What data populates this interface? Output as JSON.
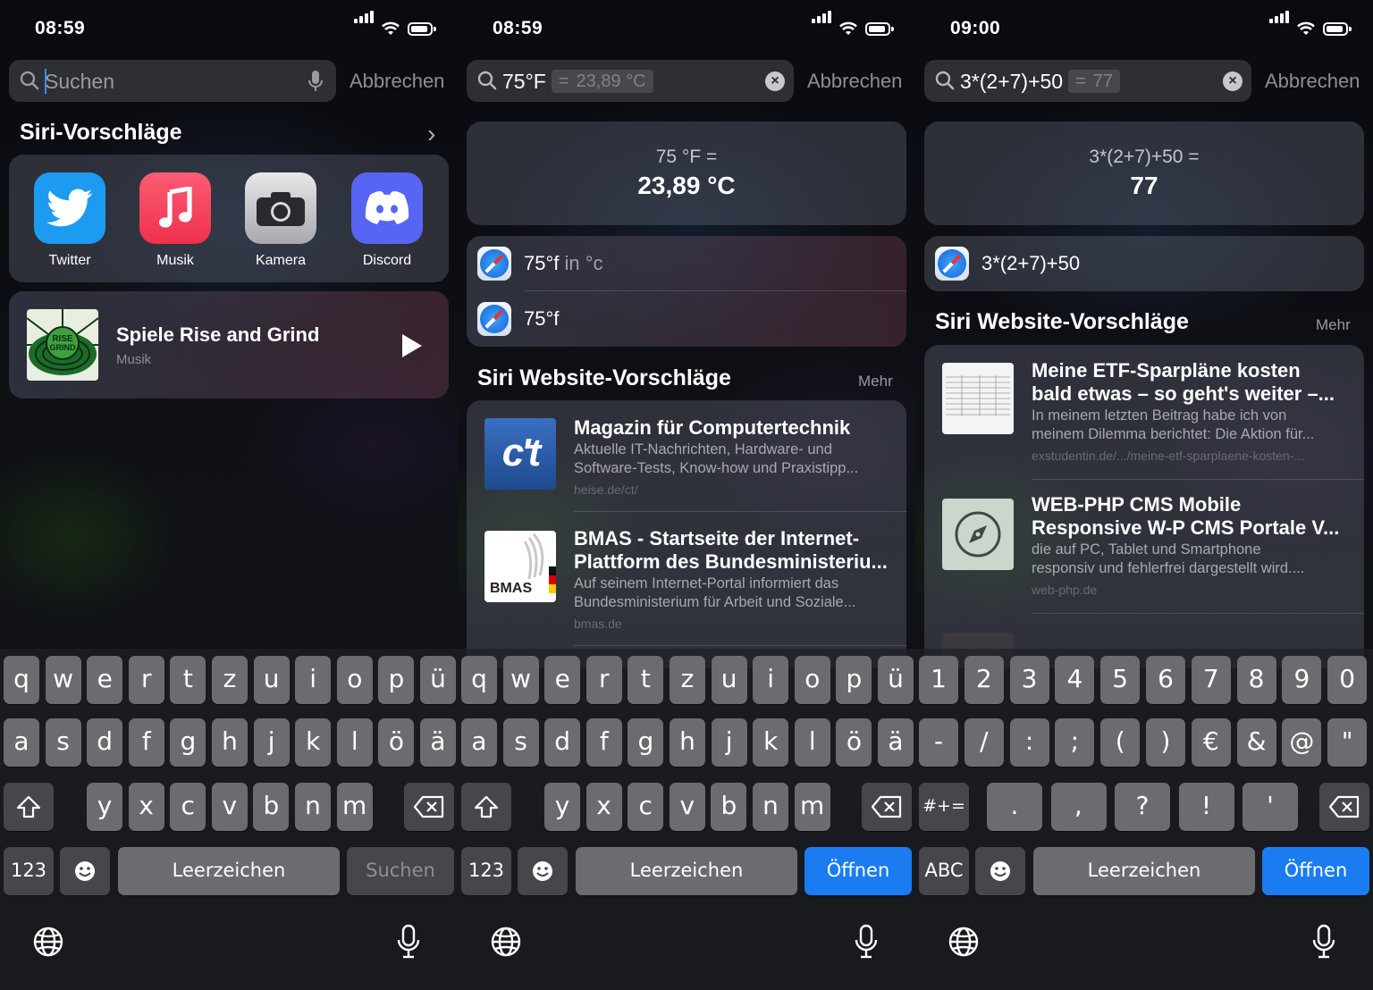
{
  "screens": [
    {
      "status": {
        "time": "08:59"
      },
      "search": {
        "query": "",
        "placeholder": "Suchen",
        "cancel": "Abbrechen"
      },
      "siri_suggestions": {
        "title": "Siri-Vorschläge",
        "apps": [
          {
            "label": "Twitter",
            "icon": "twitter-bird-icon",
            "color": "#1d9bf0"
          },
          {
            "label": "Musik",
            "icon": "music-note-icon",
            "color": "#f0405a"
          },
          {
            "label": "Kamera",
            "icon": "camera-icon",
            "color": "#c8c8cc"
          },
          {
            "label": "Discord",
            "icon": "discord-icon",
            "color": "#5865f2"
          }
        ]
      },
      "now_playing": {
        "art_text": "RISE AND GRIND",
        "title": "Spiele Rise and Grind",
        "subtitle": "Musik"
      },
      "keyboard": {
        "row1": [
          "q",
          "w",
          "e",
          "r",
          "t",
          "z",
          "u",
          "i",
          "o",
          "p",
          "ü"
        ],
        "row2": [
          "a",
          "s",
          "d",
          "f",
          "g",
          "h",
          "j",
          "k",
          "l",
          "ö",
          "ä"
        ],
        "row3": [
          "y",
          "x",
          "c",
          "v",
          "b",
          "n",
          "m"
        ],
        "mode_key": "123",
        "space": "Leerzeichen",
        "action": "Suchen"
      }
    },
    {
      "status": {
        "time": "08:59"
      },
      "search": {
        "query": "75°F",
        "result_eq": "=",
        "result": "23,89 °C",
        "cancel": "Abbrechen"
      },
      "conversion": {
        "expression": "75 °F =",
        "result": "23,89 °C"
      },
      "suggestions": [
        {
          "bold": "75°f",
          "rest": " in °c"
        },
        {
          "bold": "75°f",
          "rest": ""
        }
      ],
      "web": {
        "title": "Siri Website-Vorschläge",
        "more": "Mehr",
        "items": [
          {
            "thumb_text": "c't",
            "title": "Magazin für Computertechnik",
            "desc1": "Aktuelle IT-Nachrichten, Hardware- und",
            "desc2": "Software-Tests, Know-how und Praxistipp...",
            "url": "heise.de/ct/"
          },
          {
            "thumb_text": "BMAS",
            "title1": "BMAS - Startseite der Internet-",
            "title2": "Plattform des Bundesministeriu...",
            "desc1": "Auf seinem Internet-Portal informiert das",
            "desc2": "Bundesministerium für Arbeit und Soziale...",
            "url": "bmas.de"
          }
        ]
      },
      "keyboard": {
        "row1": [
          "q",
          "w",
          "e",
          "r",
          "t",
          "z",
          "u",
          "i",
          "o",
          "p",
          "ü"
        ],
        "row2": [
          "a",
          "s",
          "d",
          "f",
          "g",
          "h",
          "j",
          "k",
          "l",
          "ö",
          "ä"
        ],
        "row3": [
          "y",
          "x",
          "c",
          "v",
          "b",
          "n",
          "m"
        ],
        "mode_key": "123",
        "space": "Leerzeichen",
        "action": "Öffnen"
      }
    },
    {
      "status": {
        "time": "09:00"
      },
      "search": {
        "query": "3*(2+7)+50",
        "result_eq": "=",
        "result": "77",
        "cancel": "Abbrechen"
      },
      "calculation": {
        "expression": "3*(2+7)+50 =",
        "result": "77"
      },
      "suggestions": [
        {
          "bold": "3*(2+7)+50",
          "rest": ""
        }
      ],
      "web": {
        "title": "Siri Website-Vorschläge",
        "more": "Mehr",
        "items": [
          {
            "title1": "Meine ETF-Sparpläne kosten",
            "title2": "bald etwas – so geht's weiter –...",
            "desc1": "In meinem letzten Beitrag habe ich von",
            "desc2": "meinem Dilemma berichtet: Die Aktion für...",
            "url": "exstudentin.de/.../meine-etf-sparplaene-kosten-..."
          },
          {
            "title1": "WEB-PHP CMS Mobile",
            "title2": "Responsive W-P CMS Portale V...",
            "desc1": "die auf PC, Tablet und Smartphone",
            "desc2": "responsiv und fehlerfrei dargestellt wird....",
            "url": "web-php.de"
          }
        ]
      },
      "keyboard": {
        "row1": [
          "1",
          "2",
          "3",
          "4",
          "5",
          "6",
          "7",
          "8",
          "9",
          "0"
        ],
        "row2": [
          "-",
          "/",
          ":",
          ";",
          "(",
          ")",
          "€",
          "&",
          "@",
          "\""
        ],
        "row3": [
          ".",
          ",",
          "?",
          "!",
          "'"
        ],
        "shift_key": "#+=",
        "mode_key": "ABC",
        "space": "Leerzeichen",
        "action": "Öffnen"
      }
    }
  ]
}
